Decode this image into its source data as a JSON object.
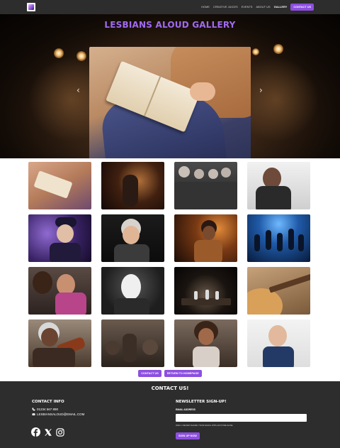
{
  "nav": {
    "logo_alt": "Lesbians Aloud logo",
    "links": [
      "Home",
      "Creative Juices",
      "Events",
      "About Us",
      "Gallery"
    ],
    "active": "Gallery",
    "cta": "Contact Us"
  },
  "hero": {
    "title": "LESBIANS ALOUD GALLERY",
    "prev_icon": "chevron-left-icon",
    "next_icon": "chevron-right-icon"
  },
  "gallery": {
    "photos": [
      "woman-reading-book",
      "singer-with-microphone-stage-lights",
      "choir-of-older-women-holding-sheets",
      "woman-singing-with-headphones",
      "woman-in-hat-singing-purple-light",
      "older-woman-laughing-at-microphone",
      "woman-singing-into-microphone-orange",
      "dancers-on-blue-stage",
      "two-women-applying-makeup",
      "person-holding-white-mask",
      "theatre-stage-performers",
      "hands-playing-acoustic-guitar",
      "older-woman-playing-violin",
      "audience-at-open-mic",
      "woman-with-curly-hair-in-crowd",
      "older-woman-with-short-hair-pointing"
    ]
  },
  "buttons": {
    "contact": "Contact Us",
    "return_home": "Return to Homepage"
  },
  "footer": {
    "title": "CONTACT US!",
    "contact_heading": "CONTACT INFO",
    "phone": "01234 567 890",
    "email": "LESBIANSALOUD@EMAIL.COM",
    "newsletter_heading": "NEWSLETTER SIGN-UP!",
    "email_label": "EMAIL ADDRESS",
    "email_placeholder": "",
    "help_text": "WE'LL NEVER SHARE YOUR EMAIL WITH ANYONE ELSE.",
    "signup_button": "SIGN UP NOW",
    "social_icons": [
      "facebook-icon",
      "x-icon",
      "instagram-icon"
    ]
  },
  "colors": {
    "accent": "#8d4fe0",
    "title_purple": "#a06bf0",
    "dark_bg": "#2d2d2d"
  }
}
